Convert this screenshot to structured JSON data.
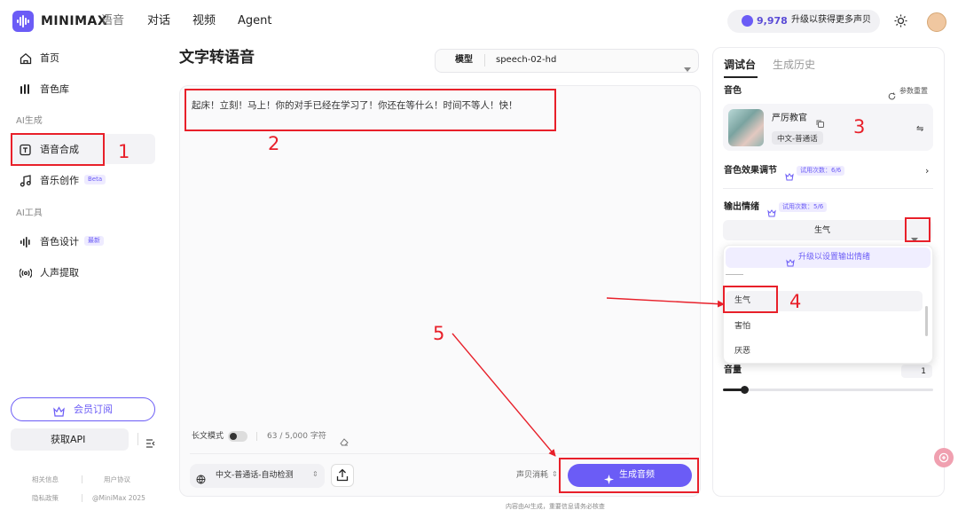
{
  "header": {
    "brand": "MINIMAX",
    "brand_sub": "语音",
    "nav": [
      "对话",
      "视频",
      "Agent"
    ],
    "credits": "9,978",
    "upgrade_text": "升级以获得更多声贝"
  },
  "sidebar": {
    "items": [
      {
        "label": "首页",
        "icon": "home-icon"
      },
      {
        "label": "音色库",
        "icon": "voice-library-icon"
      }
    ],
    "section_ai_gen": "AI生成",
    "ai_gen_items": [
      {
        "label": "语音合成",
        "icon": "tts-icon",
        "active": true
      },
      {
        "label": "音乐创作",
        "icon": "music-note-icon",
        "tag": "Beta"
      }
    ],
    "section_ai_tools": "AI工具",
    "ai_tool_items": [
      {
        "label": "音色设计",
        "icon": "waveform-icon",
        "tag": "最新"
      },
      {
        "label": "人声提取",
        "icon": "vocal-extract-icon"
      }
    ],
    "member_button": "会员订阅",
    "api_button": "获取API",
    "footer_links": [
      "相关信息",
      "用户协议",
      "隐私政策",
      "@MiniMax 2025"
    ]
  },
  "main": {
    "title": "文字转语音",
    "model_label": "模型",
    "model_value": "speech-02-hd",
    "editor_text": "起床！立刻！马上！你的对手已经在学习了！你还在等什么！时间不等人！快！",
    "long_mode_label": "长文模式",
    "char_count": "63 / 5,000 字符",
    "language_select": "中文-普通话-自动检测",
    "cost_label": "声贝消耗",
    "generate_button": "生成音频",
    "bottom_note": "内容由AI生成，重要信息请务必核查"
  },
  "right_panel": {
    "tabs": [
      "调试台",
      "生成历史"
    ],
    "voice_label": "音色",
    "reset_label": "参数重置",
    "voice_name": "严厉教官",
    "voice_tag": "中文-普通话",
    "effect_label": "音色效果调节",
    "effect_trial": "试用次数：6/6",
    "emotion_label": "输出情绪",
    "emotion_trial": "试用次数：5/6",
    "emotion_selected": "生气",
    "dropdown_header": "升级以设置输出情绪",
    "dropdown_options": [
      "生气",
      "害怕",
      "厌恶"
    ],
    "volume_label": "音量",
    "volume_value": "1",
    "volume_fraction": 0.1
  },
  "annotations": {
    "numbers": [
      "1",
      "2",
      "3",
      "4",
      "5"
    ],
    "color": "#e8202a"
  },
  "colors": {
    "accent": "#6b5cf6",
    "annotation": "#e8202a"
  }
}
